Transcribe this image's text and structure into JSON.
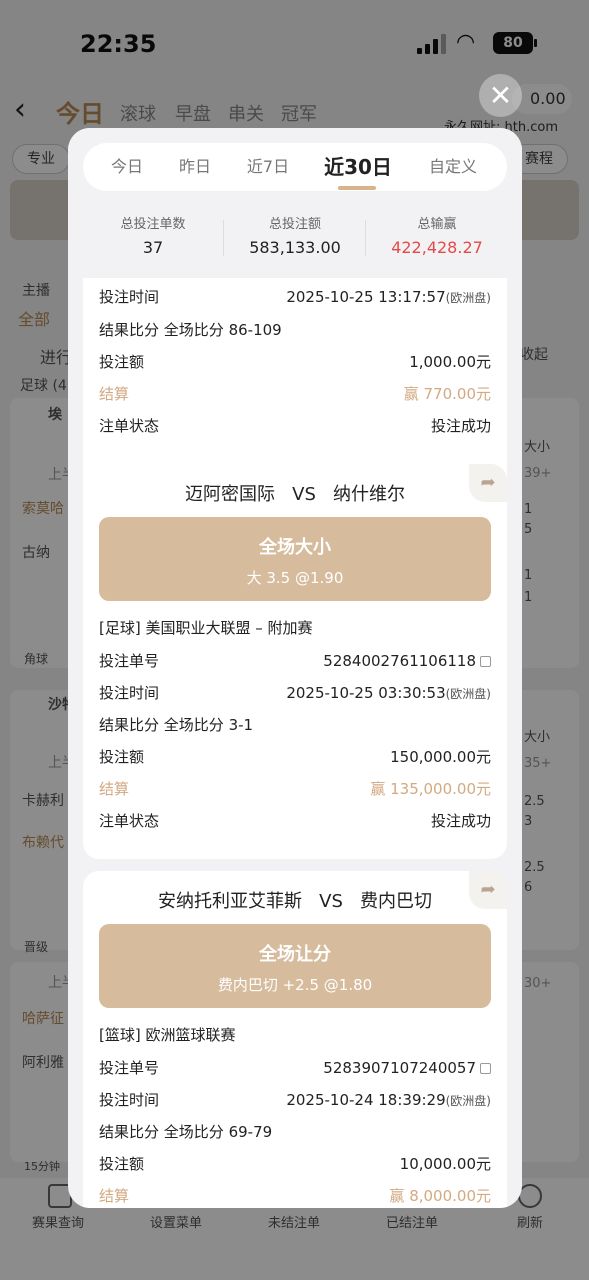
{
  "status_bar": {
    "time": "22:35",
    "battery": "80"
  },
  "background": {
    "nav_tabs": [
      "今日",
      "滚球",
      "早盘",
      "串关",
      "冠军"
    ],
    "balance": "0.00",
    "domain_label": "永久网址: hth.com",
    "pills": [
      "专业",
      "赛程"
    ],
    "rows": [
      "主播",
      "全部",
      "进行",
      "足球 (4",
      "埃",
      "上半",
      "索莫哈",
      "古纳",
      "角球",
      "沙特",
      "上半",
      "卡赫利",
      "布赖代",
      "晋级",
      "上半",
      "哈萨征",
      "阿利雅",
      "15分钟"
    ],
    "side_text": [
      "收起",
      "大小",
      "39+",
      "1",
      "5",
      "1",
      "1",
      "大小",
      "35+",
      "2.5",
      "3",
      "2.5",
      "6",
      "30+"
    ],
    "bottom_bar": [
      "赛果查询",
      "设置菜单",
      "未结注单",
      "已结注单",
      "刷新"
    ]
  },
  "modal": {
    "close_icon": "close-icon",
    "range_tabs": [
      {
        "label": "今日",
        "active": false
      },
      {
        "label": "昨日",
        "active": false
      },
      {
        "label": "近7日",
        "active": false
      },
      {
        "label": "近30日",
        "active": true
      },
      {
        "label": "自定义",
        "active": false
      }
    ],
    "summary": {
      "count_label": "总投注单数",
      "count_value": "37",
      "amount_label": "总投注额",
      "amount_value": "583,133.00",
      "winloss_label": "总输赢",
      "winloss_value": "422,428.27"
    },
    "card1": {
      "bet_time_label": "投注时间",
      "bet_time": "2025-10-25 13:17:57",
      "bet_time_suffix": "(欧洲盘)",
      "score_label": "结果比分",
      "score": "全场比分 86-109",
      "stake_label": "投注额",
      "stake": "1,000.00元",
      "settle_label": "结算",
      "settle": "赢 770.00元",
      "status_label": "注单状态",
      "status": "投注成功"
    },
    "card2": {
      "home": "迈阿密国际",
      "vs": "VS",
      "away": "纳什维尔",
      "bet_type": "全场大小",
      "pick": "大 3.5 @1.90",
      "league": "[足球] 美国职业大联盟 – 附加赛",
      "order_label": "投注单号",
      "order_no": "5284002761106118",
      "bet_time_label": "投注时间",
      "bet_time": "2025-10-25 03:30:53",
      "bet_time_suffix": "(欧洲盘)",
      "score_label": "结果比分",
      "score": "全场比分 3-1",
      "stake_label": "投注额",
      "stake": "150,000.00元",
      "settle_label": "结算",
      "settle": "赢 135,000.00元",
      "status_label": "注单状态",
      "status": "投注成功"
    },
    "card3": {
      "home": "安纳托利亚艾菲斯",
      "vs": "VS",
      "away": "费内巴切",
      "bet_type": "全场让分",
      "pick": "费内巴切 +2.5 @1.80",
      "league": "[篮球] 欧洲篮球联赛",
      "order_label": "投注单号",
      "order_no": "5283907107240057",
      "bet_time_label": "投注时间",
      "bet_time": "2025-10-24 18:39:29",
      "bet_time_suffix": "(欧洲盘)",
      "score_label": "结果比分",
      "score": "全场比分 69-79",
      "stake_label": "投注额",
      "stake": "10,000.00元",
      "settle_label": "结算",
      "settle": "赢 8,000.00元"
    }
  }
}
